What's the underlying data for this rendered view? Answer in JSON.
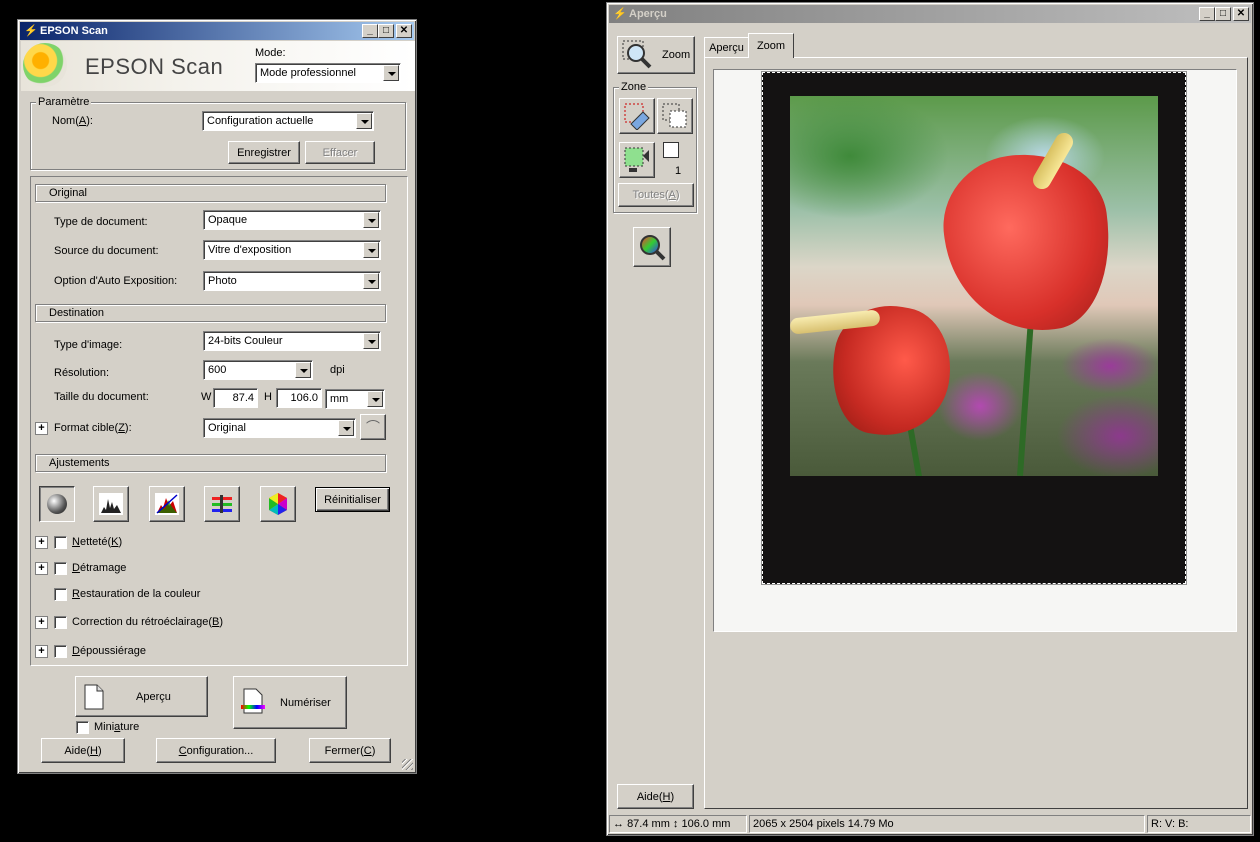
{
  "main_window": {
    "title": "EPSON Scan",
    "brand_text": "EPSON Scan",
    "mode_label": "Mode:",
    "mode_value": "Mode professionnel",
    "parametre": {
      "group_title": "Paramètre",
      "name_label": "Nom(A):",
      "name_value": "Configuration actuelle",
      "save_button": "Enregistrer",
      "delete_button": "Effacer"
    },
    "original": {
      "section_title": "Original",
      "doc_type_label": "Type de document:",
      "doc_type_value": "Opaque",
      "doc_source_label": "Source du document:",
      "doc_source_value": "Vitre d'exposition",
      "auto_exposure_label": "Option d'Auto Exposition:",
      "auto_exposure_value": "Photo"
    },
    "destination": {
      "section_title": "Destination",
      "image_type_label": "Type d'image:",
      "image_type_value": "24-bits Couleur",
      "resolution_label": "Résolution:",
      "resolution_value": "600",
      "resolution_unit": "dpi",
      "doc_size_label": "Taille du document:",
      "w_label": "W",
      "w_value": "87.4",
      "h_label": "H",
      "h_value": "106.0",
      "size_unit": "mm",
      "target_format_label": "Format cible(Z):",
      "target_format_value": "Original"
    },
    "adjustments": {
      "section_title": "Ajustements",
      "reset_button": "Réinitialiser",
      "options": [
        {
          "label": "Netteté(K)",
          "expandable": true,
          "checked": false
        },
        {
          "label": "Détramage",
          "expandable": true,
          "checked": false
        },
        {
          "label": "Restauration de la couleur",
          "expandable": false,
          "checked": false
        },
        {
          "label": "Correction du rétroéclairage(B)",
          "expandable": true,
          "checked": false
        },
        {
          "label": "Dépoussiérage",
          "expandable": true,
          "checked": false
        }
      ]
    },
    "preview_button": "Aperçu",
    "scan_button": "Numériser",
    "thumbnail_label": "Miniature",
    "help_button": "Aide(H)",
    "config_button": "Configuration...",
    "close_button": "Fermer(C)"
  },
  "preview_window": {
    "title": "Aperçu",
    "zoom_button": "Zoom",
    "zone_group": "Zone",
    "zone_count": "1",
    "all_button": "Toutes(A)",
    "tabs": [
      {
        "label": "Aperçu",
        "active": false
      },
      {
        "label": "Zoom",
        "active": true
      }
    ],
    "help_button": "Aide(H)",
    "status": {
      "width": "87.4 mm",
      "height": "106.0 mm",
      "pixels": "2065 x 2504 pixels 14.79 Mo",
      "rgb": "R: V: B:"
    }
  },
  "colors": {
    "titlebar_active": "#0a246a",
    "face": "#d4d0c8"
  }
}
